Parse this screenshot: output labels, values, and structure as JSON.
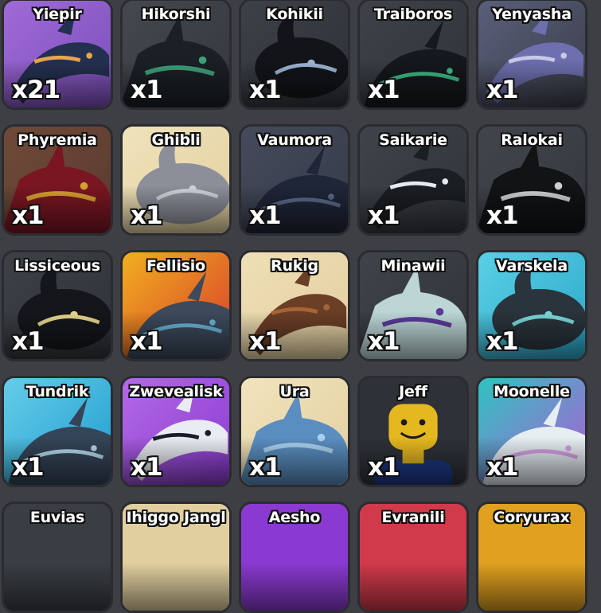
{
  "inventory": {
    "items": [
      {
        "name": "Yiepir",
        "count": "x21",
        "bg": "#7a4fb8",
        "bg2": "#a06ad8",
        "creature": "#23304f",
        "accent": "#e7a64a",
        "icon": "creature-icon"
      },
      {
        "name": "Hikorshi",
        "count": "x1",
        "bg": "#33373d",
        "bg2": "#45494f",
        "creature": "#1b2026",
        "accent": "#3fa07a",
        "icon": "creature-icon"
      },
      {
        "name": "Kohikii",
        "count": "x1",
        "bg": "#2e3238",
        "bg2": "#3d4147",
        "creature": "#121418",
        "accent": "#9fb7d6",
        "icon": "creature-icon"
      },
      {
        "name": "Traiboros",
        "count": "x1",
        "bg": "#30343a",
        "bg2": "#3e4248",
        "creature": "#15181c",
        "accent": "#3fbf8a",
        "icon": "creature-icon"
      },
      {
        "name": "Yenyasha",
        "count": "x1",
        "bg": "#3a3d48",
        "bg2": "#5a5f7a",
        "creature": "#6d6fae",
        "accent": "#c8c9e6",
        "icon": "creature-icon"
      },
      {
        "name": "Phyremia",
        "count": "x1",
        "bg": "#5a3a2e",
        "bg2": "#6f4a38",
        "creature": "#7a1622",
        "accent": "#d6a030",
        "icon": "creature-icon"
      },
      {
        "name": "Ghibli",
        "count": "x1",
        "bg": "#e2d0a0",
        "bg2": "#f0e2bb",
        "creature": "#8c8f99",
        "accent": "#cfd2da",
        "icon": "creature-icon"
      },
      {
        "name": "Vaumora",
        "count": "x1",
        "bg": "#353a48",
        "bg2": "#454b5c",
        "creature": "#1f2638",
        "accent": "#5a6a8c",
        "icon": "creature-icon"
      },
      {
        "name": "Saikarie",
        "count": "x1",
        "bg": "#30343a",
        "bg2": "#3f434a",
        "creature": "#1b1e22",
        "accent": "#e8eaf3",
        "icon": "creature-icon"
      },
      {
        "name": "Ralokai",
        "count": "x1",
        "bg": "#34383e",
        "bg2": "#42464c",
        "creature": "#111315",
        "accent": "#d0d0d0",
        "icon": "creature-icon"
      },
      {
        "name": "Lissiceous",
        "count": "x1",
        "bg": "#2f3338",
        "bg2": "#3d4147",
        "creature": "#14161a",
        "accent": "#e3d68f",
        "icon": "creature-icon"
      },
      {
        "name": "Fellisio",
        "count": "x1",
        "bg": "#d83a2a",
        "bg2": "#f0b020",
        "creature": "#3c4a5c",
        "accent": "#6bb6d8",
        "icon": "creature-icon"
      },
      {
        "name": "Rukig",
        "count": "x1",
        "bg": "#e2cfa0",
        "bg2": "#efdfb6",
        "creature": "#6b3e26",
        "accent": "#a86434",
        "icon": "creature-icon"
      },
      {
        "name": "Minawii",
        "count": "x1",
        "bg": "#30343a",
        "bg2": "#3f434a",
        "creature": "#bcd6d6",
        "accent": "#5b3a9a",
        "icon": "creature-icon"
      },
      {
        "name": "Varskela",
        "count": "x1",
        "bg": "#2aa7c8",
        "bg2": "#5ad0e6",
        "creature": "#2a343c",
        "accent": "#7ad8d8",
        "icon": "creature-icon"
      },
      {
        "name": "Tundrik",
        "count": "x1",
        "bg": "#1f9cd0",
        "bg2": "#66cde8",
        "creature": "#344558",
        "accent": "#b6dcf0",
        "icon": "creature-icon"
      },
      {
        "name": "Zwevealisk",
        "count": "x1",
        "bg": "#8a3ad0",
        "bg2": "#b36ae6",
        "creature": "#e9ecf2",
        "accent": "#1b1e2a",
        "icon": "creature-icon"
      },
      {
        "name": "Ura",
        "count": "x1",
        "bg": "#e3d0a0",
        "bg2": "#f1e3bd",
        "creature": "#5a8ec0",
        "accent": "#a9d1ee",
        "icon": "creature-icon"
      },
      {
        "name": "Jeff",
        "count": "x1",
        "bg": "#2e3238",
        "bg2": "#3d4147",
        "creature": "#e6b820",
        "accent": "#1d3a8a",
        "icon": "avatar-icon"
      },
      {
        "name": "Moonelle",
        "count": "x1",
        "bg": "#b25ad6",
        "bg2": "#2ec4c0",
        "creature": "#e6eef2",
        "accent": "#d6a0e6",
        "icon": "creature-icon"
      },
      {
        "name": "Euvias",
        "count": "",
        "bg": "#3a3e44",
        "bg2": "#3a3e44",
        "creature": "#3a3e44",
        "accent": "#3a3e44",
        "icon": "creature-icon"
      },
      {
        "name": "Ihiggo Jangl",
        "count": "",
        "bg": "#e2cfa0",
        "bg2": "#e2cfa0",
        "creature": "#e2cfa0",
        "accent": "#e2cfa0",
        "icon": "creature-icon"
      },
      {
        "name": "Aesho",
        "count": "",
        "bg": "#8a3ad0",
        "bg2": "#8a3ad0",
        "creature": "#8a3ad0",
        "accent": "#8a3ad0",
        "icon": "creature-icon"
      },
      {
        "name": "Evranili",
        "count": "",
        "bg": "#d03a4a",
        "bg2": "#d03a4a",
        "creature": "#d03a4a",
        "accent": "#d03a4a",
        "icon": "creature-icon"
      },
      {
        "name": "Coryurax",
        "count": "",
        "bg": "#e0a020",
        "bg2": "#e0a020",
        "creature": "#e0a020",
        "accent": "#e0a020",
        "icon": "creature-icon"
      }
    ]
  }
}
